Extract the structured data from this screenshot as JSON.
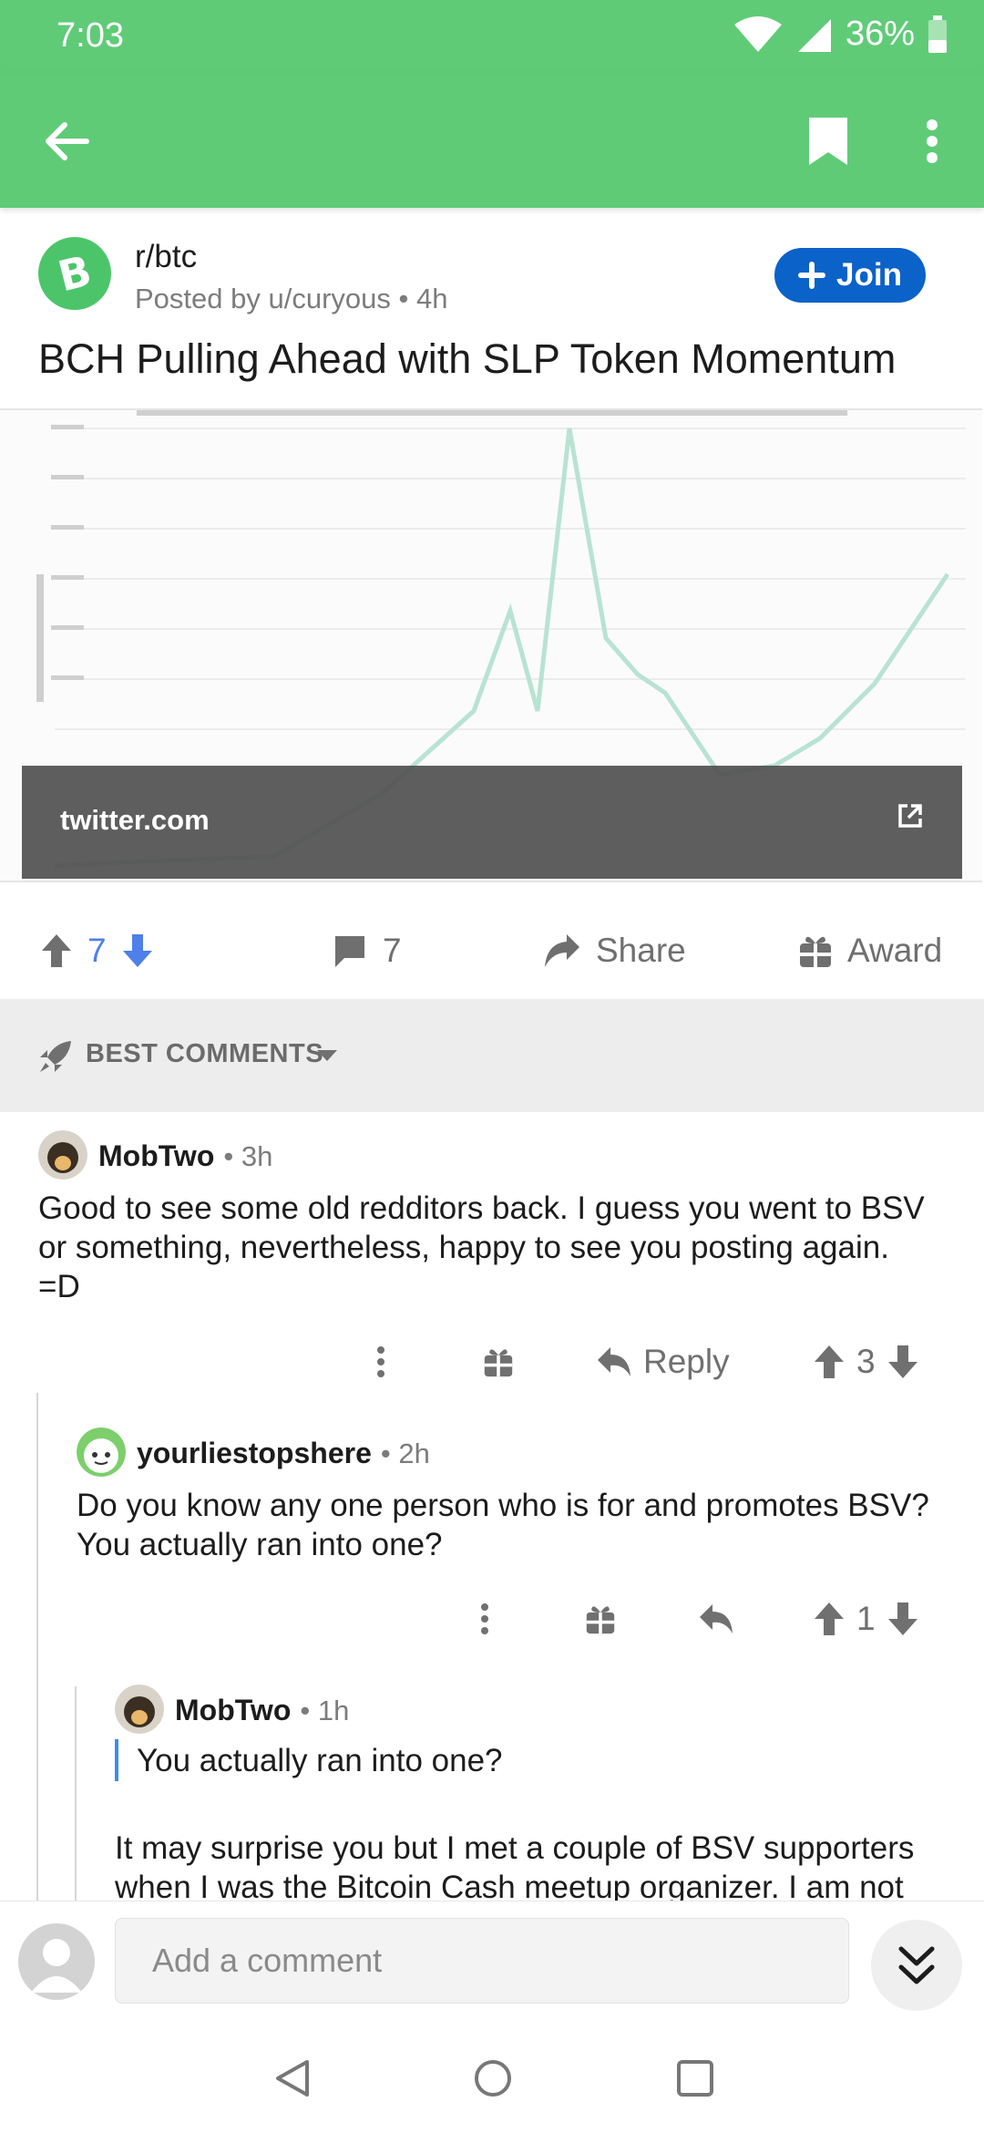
{
  "status_bar": {
    "time": "7:03",
    "battery": "36%"
  },
  "toolbar": {
    "back_icon": "arrow-left-icon",
    "bookmark_icon": "bookmark-icon",
    "more_icon": "more-vertical-icon"
  },
  "post": {
    "subreddit": "r/btc",
    "posted_by": "Posted by u/curyous • 4h",
    "join_label": "Join",
    "title": "BCH Pulling Ahead with SLP Token Momentum",
    "preview_domain": "twitter.com",
    "upvotes": "7",
    "comments": "7",
    "share_label": "Share",
    "award_label": "Award"
  },
  "sort": {
    "label": "BEST COMMENTS"
  },
  "comments": [
    {
      "author": "MobTwo",
      "meta": "• 3h",
      "body": "Good to see some old redditors back. I guess you went to BSV or something, nevertheless, happy to see you posting again. =D",
      "reply_label": "Reply",
      "score": "3"
    },
    {
      "author": "yourliestopshere",
      "meta": "• 2h",
      "body": "Do you know any one person who is for and promotes BSV? You actually ran into one?",
      "score": "1"
    },
    {
      "author": "MobTwo",
      "meta": "• 1h",
      "quote": "You actually ran into one?",
      "body": "It may surprise you but I met a couple of BSV supporters when I was the Bitcoin Cash meetup organizer. I am not"
    }
  ],
  "composer": {
    "placeholder": "Add a comment"
  },
  "colors": {
    "header_green": "#5fcb77",
    "join_blue": "#0b62c9",
    "upvote_blue": "#4f7fe9",
    "quote_blue": "#3d8fe8"
  }
}
